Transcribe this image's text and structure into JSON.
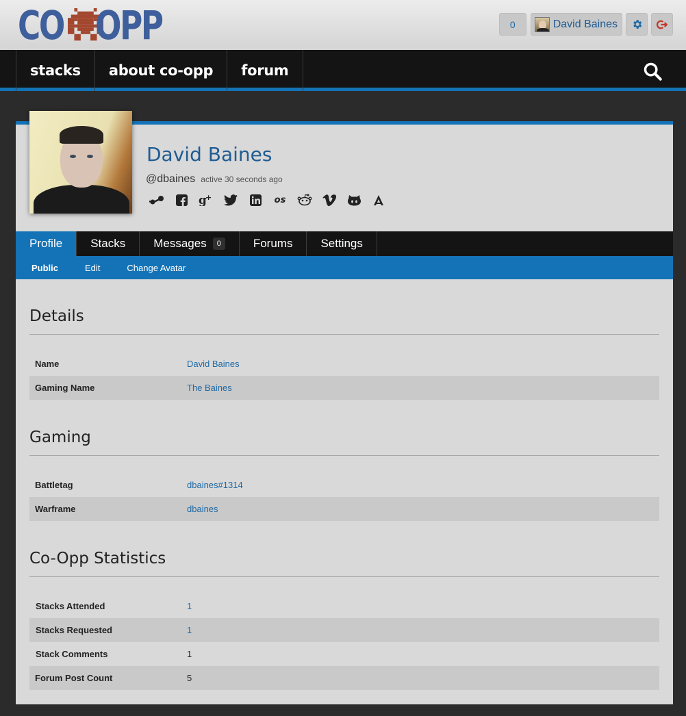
{
  "header": {
    "logo": {
      "left": "CO",
      "right": "OPP",
      "colors": {
        "text": "#3e5f9c",
        "invader": "#a3472f"
      }
    },
    "notifications_count": "0",
    "user_name": "David Baines"
  },
  "nav": {
    "items": [
      "stacks",
      "about co-opp",
      "forum"
    ]
  },
  "profile": {
    "name": "David Baines",
    "handle": "@dbaines",
    "status": "active 30 seconds ago",
    "socials": [
      "steam-icon",
      "facebook-icon",
      "google-plus-icon",
      "twitter-icon",
      "linkedin-icon",
      "lastfm-icon",
      "reddit-icon",
      "vimeo-icon",
      "github-icon",
      "app-net-icon"
    ]
  },
  "tabs": {
    "items": [
      {
        "label": "Profile"
      },
      {
        "label": "Stacks"
      },
      {
        "label": "Messages",
        "badge": "0"
      },
      {
        "label": "Forums"
      },
      {
        "label": "Settings"
      }
    ],
    "active": "Profile"
  },
  "subtabs": {
    "items": [
      "Public",
      "Edit",
      "Change Avatar"
    ],
    "active": "Public"
  },
  "sections": {
    "details": {
      "title": "Details",
      "rows": [
        {
          "label": "Name",
          "value": "David Baines"
        },
        {
          "label": "Gaming Name",
          "value": "The Baines"
        }
      ]
    },
    "gaming": {
      "title": "Gaming",
      "rows": [
        {
          "label": "Battletag",
          "value": "dbaines#1314"
        },
        {
          "label": "Warframe",
          "value": "dbaines"
        }
      ]
    },
    "stats": {
      "title": "Co-Opp Statistics",
      "rows": [
        {
          "label": "Stacks Attended",
          "value": "1"
        },
        {
          "label": "Stacks Requested",
          "value": "1"
        },
        {
          "label": "Stack Comments",
          "value": "1"
        },
        {
          "label": "Forum Post Count",
          "value": "5"
        }
      ]
    }
  },
  "colors": {
    "accent": "#1473b6",
    "nav_bg": "#141414",
    "link": "#1f6aa5",
    "panel_bg": "#d9d9d9"
  }
}
